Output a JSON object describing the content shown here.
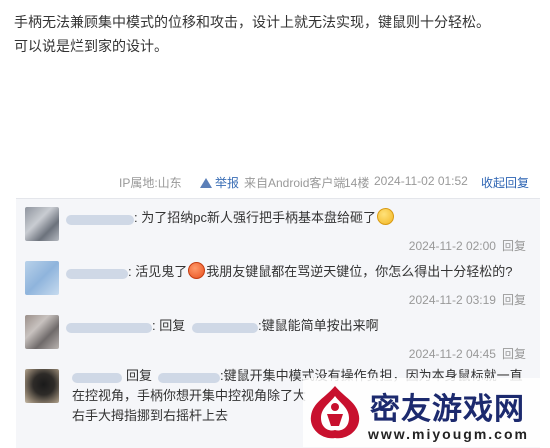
{
  "post": {
    "line1": "手柄无法兼顾集中模式的位移和攻击，设计上就无法实现，键鼠则十分轻松。",
    "line2": "可以说是烂到家的设计。"
  },
  "meta": {
    "ip": "IP属地:山东",
    "report": "举报",
    "source": "来自Android客户端",
    "floor": "14楼",
    "time": "2024-11-02 01:52",
    "collapse": "收起回复"
  },
  "replies": [
    {
      "text": ": 为了招纳pc新人强行把手柄基本盘给砸了",
      "time": "2024-11-2 02:00",
      "reply_btn": "回复"
    },
    {
      "text_a": ": 活见鬼了",
      "text_b": "我朋友键鼠都在骂逆天键位，你怎么得出十分轻松的?",
      "time": "2024-11-2 03:19",
      "reply_btn": "回复"
    },
    {
      "prefix": ": 回复",
      "text": ":键鼠能简单按出来啊",
      "time": "2024-11-2 04:45",
      "reply_btn": "回复"
    },
    {
      "prefix": "回复",
      "line1": ":键鼠开集中模式没有操作负担，因为本身鼠标就一直",
      "line2": "在控视角，手柄你想开集中控视角除了大",
      "line3": "右手大拇指挪到右摇杆上去"
    }
  ],
  "watermark": {
    "name": "密友游戏网",
    "url": "www.miyougm.com"
  },
  "colors": {
    "link": "#2d64b3",
    "panel_bg": "#f5f6f9",
    "meta_text": "#999999",
    "watermark_red": "#c8102e",
    "watermark_navy": "#1c2a6e"
  },
  "icons": [
    "warning-icon",
    "smile-emoji-icon",
    "orange-face-emoji-icon",
    "watermark-logo-icon"
  ]
}
